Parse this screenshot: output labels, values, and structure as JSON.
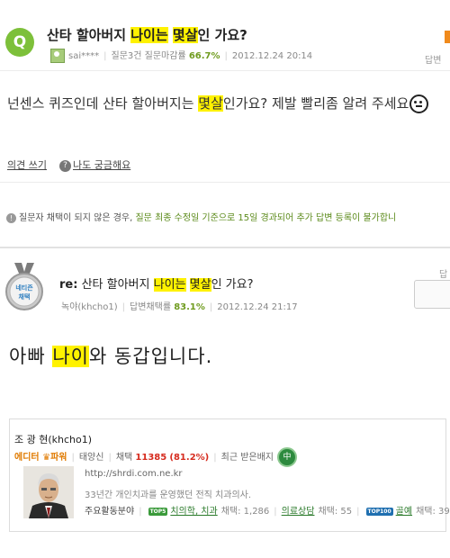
{
  "question": {
    "badge": "Q",
    "title_before": "산타 할아버지 ",
    "title_highlight_1": "나이는",
    "title_mid": " ",
    "title_highlight_2": "몇살",
    "title_after": "인 가요?",
    "author": "sai****",
    "stats_prefix": "질문3건 질문마감률 ",
    "close_rate": "66.7%",
    "date": "2012.12.24 20:14",
    "right_label": "답변",
    "body_before": "넌센스 퀴즈인데 산타 할아버지는 ",
    "body_highlight": "몇살",
    "body_after": "인가요? 제발 빨리좀 알려 주세요"
  },
  "actions": {
    "opinion": "의견 쓰기",
    "curious_icon": "?",
    "curious": "나도 궁금해요"
  },
  "notice": {
    "icon": "!",
    "part1": "질문자 채택이 되지 않은 경우, ",
    "part2": "질문 최종 수정일 기준으로 15일 경과되어 추가 답변 등록이 불가합니",
    "part3": ""
  },
  "answer": {
    "medal_line1": "네티즌",
    "medal_line2": "채택",
    "title_prefix": "re:",
    "title_before": " 산타 할아버지 ",
    "title_highlight_1": "나이는",
    "title_mid": " ",
    "title_highlight_2": "몇살",
    "title_after": "인 가요?",
    "author": "녹야(khcho1)",
    "adopt_prefix": "답변채택률 ",
    "adopt_rate": "83.1%",
    "date": "2012.12.24 21:17",
    "right_label": "답",
    "body_before": "아빠 ",
    "body_highlight": "나이",
    "body_after": "와 동갑입니다."
  },
  "profile": {
    "name": "조 광 현(khcho1)",
    "level_prefix": "에디터 ",
    "level_crown": "♛",
    "level_suffix": "파워",
    "nickname": "태양신",
    "adopt_label": "채택 ",
    "adopt_count": "11385",
    "adopt_pct": "(81.2%)",
    "badge_label": "최근 받은배지",
    "badge_icon": "中",
    "url": "http://shrdi.com.ne.kr",
    "desc": "33년간 개인치과를 운영했던 전직 치과의사.",
    "fields_label": "주요활동분야",
    "fields": [
      {
        "badge": "TOP5",
        "name": "치의학, 치과",
        "count": "채택: 1,286"
      },
      {
        "badge": "",
        "name": "의료상담",
        "count": "채택: 55"
      },
      {
        "badge": "TOP100",
        "name": "골예",
        "count": "채택: 39"
      }
    ]
  },
  "colors": {
    "highlight": "#fff200",
    "brand_green": "#7dc03a",
    "score_red": "#d62b1e",
    "power_orange": "#e07a00"
  }
}
